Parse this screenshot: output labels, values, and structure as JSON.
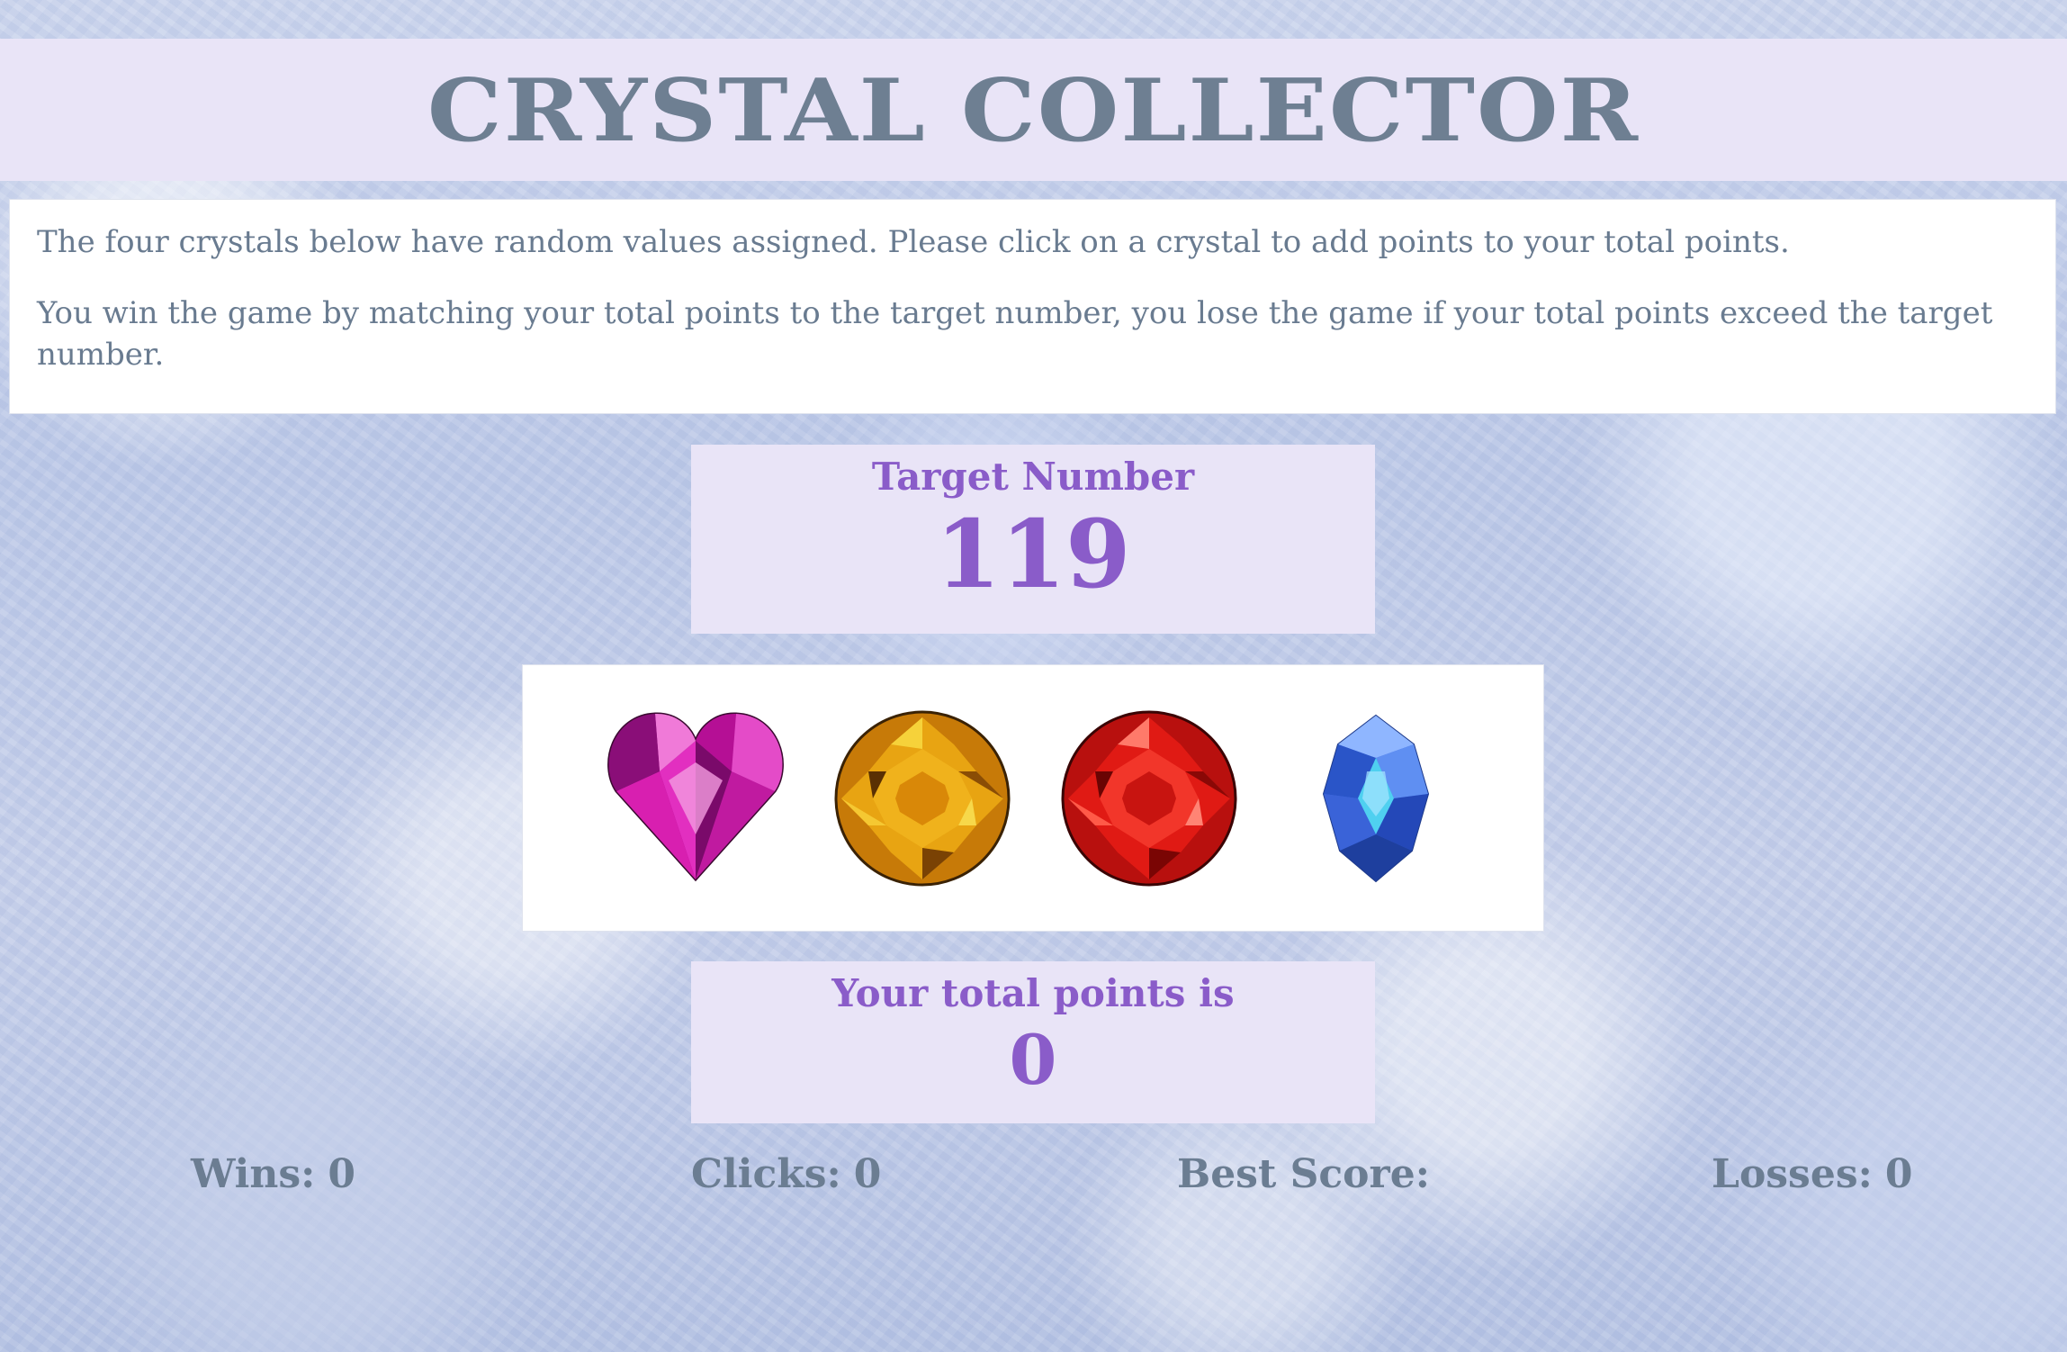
{
  "header": {
    "title": "CRYSTAL COLLECTOR"
  },
  "instructions": {
    "line1": "The four crystals below have random values assigned. Please click on a crystal to add points to your total points.",
    "line2": "You win the game by matching your total points to the target number, you lose the game if your total points exceed the target number."
  },
  "target": {
    "label": "Target Number",
    "value": "119"
  },
  "crystals": [
    {
      "name": "heart-crystal-icon",
      "color": "#c21aa5"
    },
    {
      "name": "orange-round-crystal-icon",
      "color": "#e0940e"
    },
    {
      "name": "red-round-crystal-icon",
      "color": "#e01512"
    },
    {
      "name": "blue-crystal-icon",
      "color": "#3f6ee6"
    }
  ],
  "total": {
    "label": "Your total points is",
    "value": "0"
  },
  "stats": {
    "wins_label": "Wins:",
    "wins": "0",
    "clicks_label": "Clicks:",
    "clicks": "0",
    "best_label": "Best Score:",
    "best": "",
    "losses_label": "Losses:",
    "losses": "0"
  },
  "colors": {
    "panel_bg": "#e9e4f7",
    "accent_purple": "#8a5cc9",
    "title_gray": "#6e7f92"
  }
}
